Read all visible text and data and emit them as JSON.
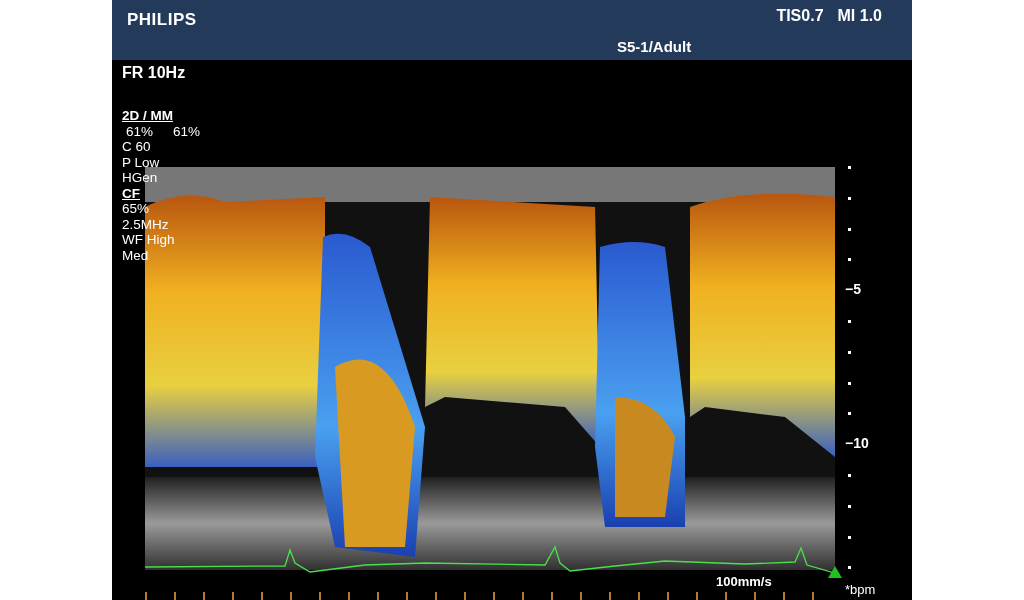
{
  "header": {
    "brand": "PHILIPS",
    "readouts": [
      "TIS0.7",
      "MI 1.0"
    ],
    "probe": "S5-1/Adult"
  },
  "frame_rate": "FR 10Hz",
  "params": [
    {
      "kind": "heading",
      "texts": [
        "2D / MM"
      ]
    },
    {
      "kind": "value",
      "texts": [
        "61%",
        "61%"
      ]
    },
    {
      "kind": "value",
      "texts": [
        "C 60"
      ]
    },
    {
      "kind": "value",
      "texts": [
        "P Low"
      ]
    },
    {
      "kind": "value",
      "texts": [
        "HGen"
      ]
    },
    {
      "kind": "heading",
      "texts": [
        "CF"
      ]
    },
    {
      "kind": "value",
      "texts": [
        "65%"
      ]
    },
    {
      "kind": "value",
      "texts": [
        "2.5MHz"
      ]
    },
    {
      "kind": "value",
      "texts": [
        "WF High"
      ]
    },
    {
      "kind": "value",
      "texts": [
        "Med"
      ]
    }
  ],
  "depth_labels": [
    "−5",
    "−10"
  ],
  "sweep_speed": "100mm/s",
  "heart_rate": "*bpm"
}
